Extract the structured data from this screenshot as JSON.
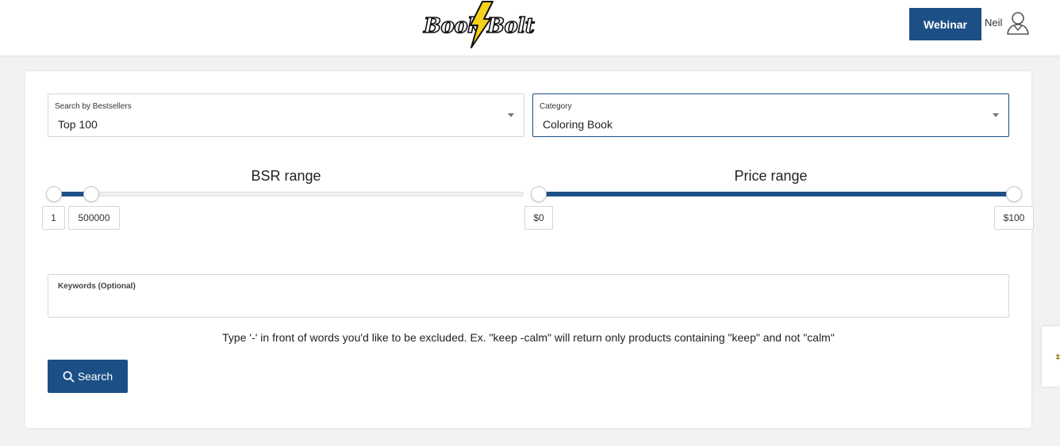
{
  "header": {
    "logo": {
      "word1": "Book",
      "word2": "Bolt"
    },
    "webinar_label": "Webinar",
    "user_name": "Neil"
  },
  "filters": {
    "bestsellers": {
      "label": "Search by Bestsellers",
      "value": "Top 100"
    },
    "category": {
      "label": "Category",
      "value": "Coloring Book"
    }
  },
  "bsr_range": {
    "title": "BSR range",
    "min_label": "1",
    "max_label": "500000",
    "fill_fraction": [
      0,
      0.08
    ]
  },
  "price_range": {
    "title": "Price range",
    "min_label": "$0",
    "max_label": "$100",
    "fill_fraction": [
      0,
      1
    ]
  },
  "keywords": {
    "label": "Keywords (Optional)",
    "value": ""
  },
  "hint": "Type '-' in front of words you'd like to be excluded. Ex. \"keep -calm\" will return only products containing \"keep\" and not \"calm\"",
  "search_label": "Search",
  "colors": {
    "primary": "#1b4f86",
    "border": "#d6d6d6",
    "background": "#f2f2f2"
  },
  "icons": {
    "avatar": "user-avatar-icon",
    "search": "search-icon",
    "caret": "caret-down-icon",
    "logo_bolt": "lightning-bolt-icon"
  }
}
